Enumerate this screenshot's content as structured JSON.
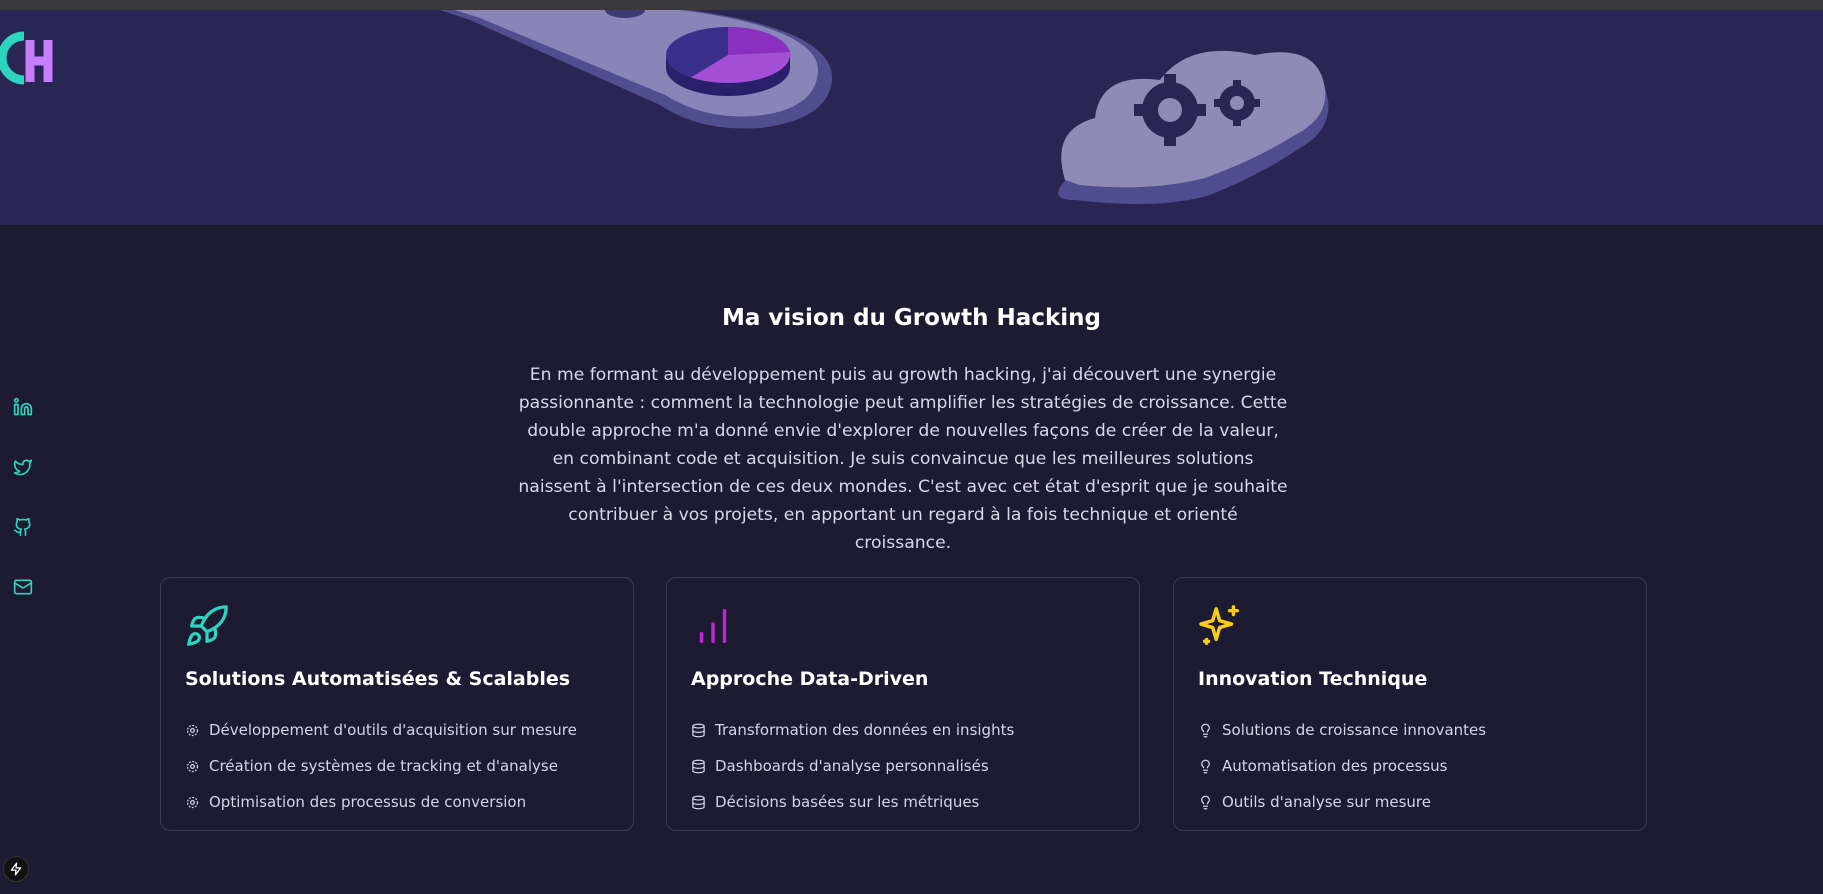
{
  "section": {
    "title": "Ma vision du Growth Hacking",
    "intro": "En me formant au développement puis au growth hacking, j'ai découvert une synergie passionnante : comment la technologie peut amplifier les stratégies de croissance. Cette double approche m'a donné envie d'explorer de nouvelles façons de créer de la valeur, en combinant code et acquisition. Je suis convaincue que les meilleures solutions naissent à l'intersection de ces deux mondes. C'est avec cet état d'esprit que je souhaite contribuer à vos projets, en apportant un regard à la fois technique et orienté croissance."
  },
  "social": [
    {
      "icon": "linkedin-icon"
    },
    {
      "icon": "twitter-icon"
    },
    {
      "icon": "github-icon"
    },
    {
      "icon": "mail-icon"
    }
  ],
  "cards": [
    {
      "icon": "rocket-icon",
      "title": "Solutions Automatisées & Scalables",
      "bullet_icon": "gear-icon",
      "items": [
        "Développement d'outils d'acquisition sur mesure",
        "Création de systèmes de tracking et d'analyse",
        "Optimisation des processus de conversion"
      ]
    },
    {
      "icon": "bar-chart-icon",
      "title": "Approche Data-Driven",
      "bullet_icon": "database-icon",
      "items": [
        "Transformation des données en insights",
        "Dashboards d'analyse personnalisés",
        "Décisions basées sur les métriques"
      ]
    },
    {
      "icon": "sparkles-icon",
      "title": "Innovation Technique",
      "bullet_icon": "lightbulb-icon",
      "items": [
        "Solutions de croissance innovantes",
        "Automatisation des processus",
        "Outils d'analyse sur mesure"
      ]
    }
  ],
  "colors": {
    "background": "#1c1b31",
    "hero": "#2a2653",
    "teal": "#2dd4bf",
    "purple": "#c026d3",
    "yellow": "#facc15",
    "card_border": "#3b3a55"
  }
}
